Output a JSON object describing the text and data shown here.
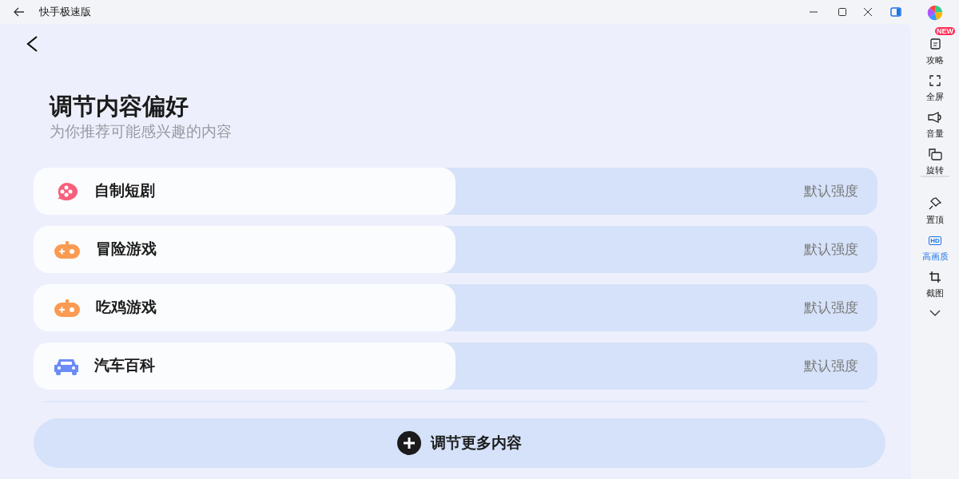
{
  "window": {
    "title": "快手极速版"
  },
  "page": {
    "title": "调节内容偏好",
    "subtitle": "为你推荐可能感兴趣的内容"
  },
  "categories": [
    {
      "name": "自制短剧",
      "kind": "film",
      "color": "#f7607a",
      "level": 0.5,
      "reading": "默认强度"
    },
    {
      "name": "冒险游戏",
      "kind": "gamepad",
      "color": "#fb9a52",
      "level": 0.5,
      "reading": "默认强度"
    },
    {
      "name": "吃鸡游戏",
      "kind": "gamepad",
      "color": "#fb9a52",
      "level": 0.5,
      "reading": "默认强度"
    },
    {
      "name": "汽车百科",
      "kind": "car",
      "color": "#6b8cf7",
      "level": 0.5,
      "reading": "默认强度"
    }
  ],
  "more_button": {
    "label": "调节更多内容"
  },
  "sidebar": {
    "items": [
      {
        "label": "攻略",
        "kind": "guide",
        "badge": "NEW",
        "selected": false
      },
      {
        "label": "全屏",
        "kind": "fullscreen",
        "selected": false
      },
      {
        "label": "音量",
        "kind": "volume",
        "selected": false
      },
      {
        "label": "旋转",
        "kind": "rotate",
        "selected": false
      },
      {
        "label": "置顶",
        "kind": "pin",
        "selected": false
      },
      {
        "label": "高画质",
        "kind": "hd",
        "badge_text": "HD",
        "selected": true
      },
      {
        "label": "截图",
        "kind": "crop",
        "selected": false
      }
    ]
  }
}
